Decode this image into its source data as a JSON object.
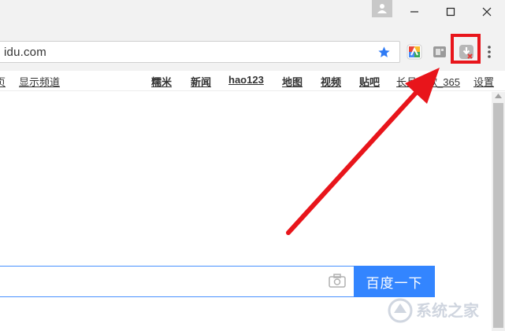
{
  "browser": {
    "address": "idu.com"
  },
  "baidu": {
    "nav_left": [
      "页",
      "显示频道"
    ],
    "nav_right": [
      "糯米",
      "新闻",
      "hao123",
      "地图",
      "视频",
      "贴吧",
      "长月如歌_365",
      "设置"
    ],
    "search_button": "百度一下",
    "search_value": ""
  },
  "icons": {
    "bookmark": "star-icon",
    "extensions": [
      "colorful-extension-icon",
      "gray-extension-icon",
      "download-blocked-extension-icon"
    ],
    "menu": "three-dot-menu-icon"
  },
  "annotation": {
    "highlight_color": "#e8151b",
    "arrow_color": "#e8151b"
  },
  "watermark": {
    "brand": "系统之家"
  },
  "colors": {
    "accent": "#3385ff",
    "star": "#2f7bf5"
  }
}
